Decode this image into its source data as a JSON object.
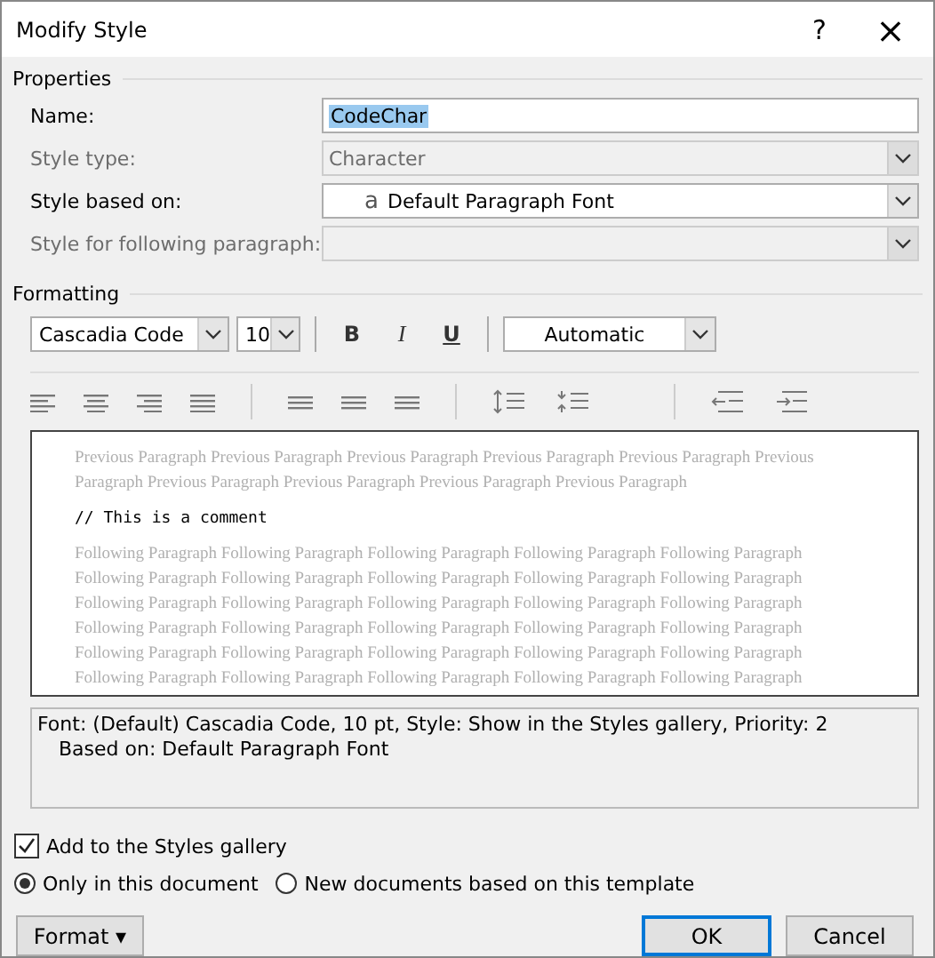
{
  "window": {
    "title": "Modify Style",
    "help": "?",
    "close": "×"
  },
  "properties": {
    "heading": "Properties",
    "fields": [
      {
        "label": "Name:",
        "kind": "text",
        "value": "CodeChar",
        "disabled": false
      },
      {
        "label": "Style type:",
        "kind": "combo",
        "value": "Character",
        "disabled": true
      },
      {
        "label": "Style based on:",
        "kind": "combo",
        "icon": "a",
        "value": "Default Paragraph Font",
        "disabled": false
      },
      {
        "label": "Style for following paragraph:",
        "kind": "combo",
        "disabled": true
      }
    ]
  },
  "formatting": {
    "heading": "Formatting",
    "font": "Cascadia Code",
    "size": "10",
    "styles": [
      "B",
      "I",
      "U"
    ],
    "font_color": "Automatic",
    "preview": {
      "previous": [
        "Previous Paragraph Previous Paragraph Previous Paragraph Previous Paragraph Previous Paragraph Previous",
        "Paragraph Previous Paragraph Previous Paragraph Previous Paragraph Previous Paragraph"
      ],
      "sample": "// This is a comment",
      "following": [
        "Following Paragraph Following Paragraph Following Paragraph Following Paragraph Following Paragraph",
        "Following Paragraph Following Paragraph Following Paragraph Following Paragraph Following Paragraph",
        "Following Paragraph Following Paragraph Following Paragraph Following Paragraph Following Paragraph",
        "Following Paragraph Following Paragraph Following Paragraph Following Paragraph Following Paragraph",
        "Following Paragraph Following Paragraph Following Paragraph Following Paragraph Following Paragraph",
        "Following Paragraph Following Paragraph Following Paragraph Following Paragraph Following Paragraph"
      ]
    },
    "description": [
      "Font: (Default) Cascadia Code, 10 pt, Style: Show in the Styles gallery, Priority: 2",
      "Based on: Default Paragraph Font"
    ]
  },
  "add_to_gallery": {
    "label": "Add to the Styles gallery",
    "checked": true
  },
  "scope": [
    {
      "label": "Only in this document",
      "selected": true
    },
    {
      "label": "New documents based on this template",
      "selected": false
    }
  ],
  "buttons": {
    "format": "Format",
    "caret": "▾",
    "ok": "OK",
    "cancel": "Cancel"
  }
}
